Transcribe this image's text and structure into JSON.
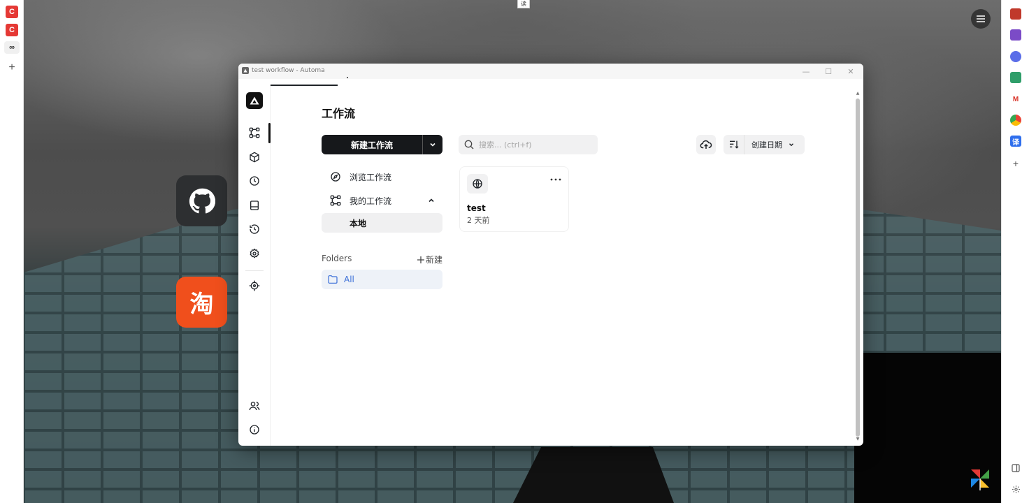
{
  "window": {
    "title": "test workflow - Automa",
    "controls": {
      "minimize": "—",
      "maximize": "☐",
      "close": "✕"
    }
  },
  "top_tab": {
    "label": "读"
  },
  "left_strip": {
    "items": [
      {
        "label": "C"
      },
      {
        "label": "C"
      },
      {
        "label": "∞"
      },
      {
        "label": "+"
      }
    ]
  },
  "right_strip": {
    "items": [
      {
        "label": ""
      },
      {
        "label": ""
      },
      {
        "label": ""
      },
      {
        "label": ""
      },
      {
        "label": "M"
      },
      {
        "label": ""
      },
      {
        "label": "译"
      },
      {
        "label": "+"
      }
    ]
  },
  "desktop": {
    "taobao_label": "淘"
  },
  "sidebar": {
    "items": [
      {
        "icon": "workflow-icon",
        "active": true
      },
      {
        "icon": "package-icon"
      },
      {
        "icon": "clock-icon"
      },
      {
        "icon": "storage-icon"
      },
      {
        "icon": "history-icon"
      },
      {
        "icon": "settings-icon"
      },
      {
        "icon": "crosshair-icon"
      },
      {
        "icon": "users-icon"
      },
      {
        "icon": "info-icon"
      }
    ]
  },
  "main": {
    "title": "工作流",
    "new_button": {
      "label": "新建工作流"
    },
    "search": {
      "placeholder": "搜索... (ctrl+f)",
      "value": ""
    },
    "sort": {
      "label": "创建日期"
    },
    "nav": {
      "browse_label": "浏览工作流",
      "my_label": "我的工作流",
      "local_label": "本地"
    },
    "folders": {
      "label": "Folders",
      "new_label": "新建",
      "all_label": "All"
    },
    "workflows": [
      {
        "name": "test",
        "time": "2 天前"
      }
    ]
  },
  "colors": {
    "accent": "#16181b",
    "folder_active": "#3b6fd8",
    "taobao": "#f04f1c",
    "github": "#2d2f31"
  }
}
